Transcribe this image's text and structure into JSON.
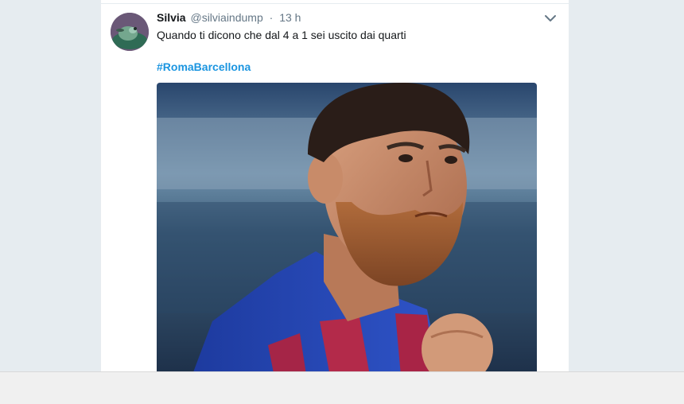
{
  "tweet": {
    "display_name": "Silvia",
    "handle": "@silviaindump",
    "separator": "·",
    "time": "13 h",
    "text": "Quando ti dicono che dal 4 a 1 sei uscito dai quarti",
    "hashtag": "#RomaBarcellona"
  },
  "colors": {
    "background": "#e6ecf0",
    "card": "#ffffff",
    "link": "#1b95e0",
    "muted": "#657786"
  },
  "icons": {
    "menu": "chevron-down-icon"
  }
}
